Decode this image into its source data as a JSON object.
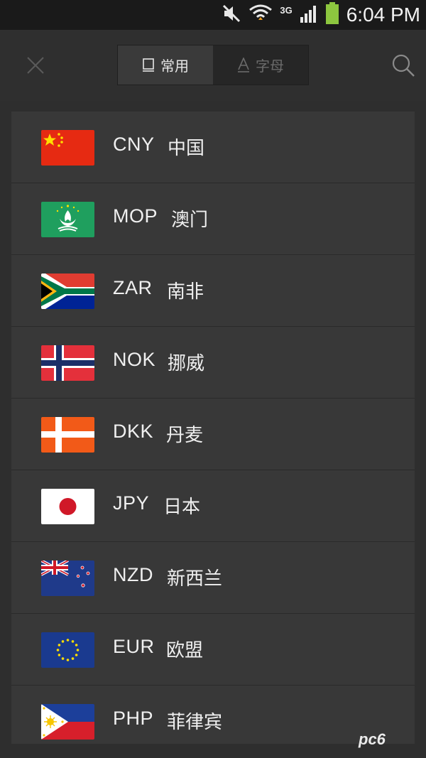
{
  "status_bar": {
    "time": "6:04 PM",
    "network": "3G",
    "icons": [
      "mute-icon",
      "wifi-icon",
      "signal-icon",
      "battery-icon"
    ]
  },
  "header": {
    "close_icon": "close-icon",
    "search_icon": "search-icon",
    "tabs": [
      {
        "label": "常用",
        "icon": "square-icon",
        "active": true
      },
      {
        "label": "字母",
        "icon": "letter-a-icon",
        "active": false
      }
    ]
  },
  "currencies": [
    {
      "code": "CNY",
      "name": "中国",
      "flag": "china-flag-icon"
    },
    {
      "code": "MOP",
      "name": "澳门",
      "flag": "macau-flag-icon"
    },
    {
      "code": "ZAR",
      "name": "南非",
      "flag": "south-africa-flag-icon"
    },
    {
      "code": "NOK",
      "name": "挪威",
      "flag": "norway-flag-icon"
    },
    {
      "code": "DKK",
      "name": "丹麦",
      "flag": "denmark-flag-icon"
    },
    {
      "code": "JPY",
      "name": "日本",
      "flag": "japan-flag-icon"
    },
    {
      "code": "NZD",
      "name": "新西兰",
      "flag": "new-zealand-flag-icon"
    },
    {
      "code": "EUR",
      "name": "欧盟",
      "flag": "eu-flag-icon"
    },
    {
      "code": "PHP",
      "name": "菲律宾",
      "flag": "philippines-flag-icon"
    }
  ],
  "watermark": "pc6"
}
